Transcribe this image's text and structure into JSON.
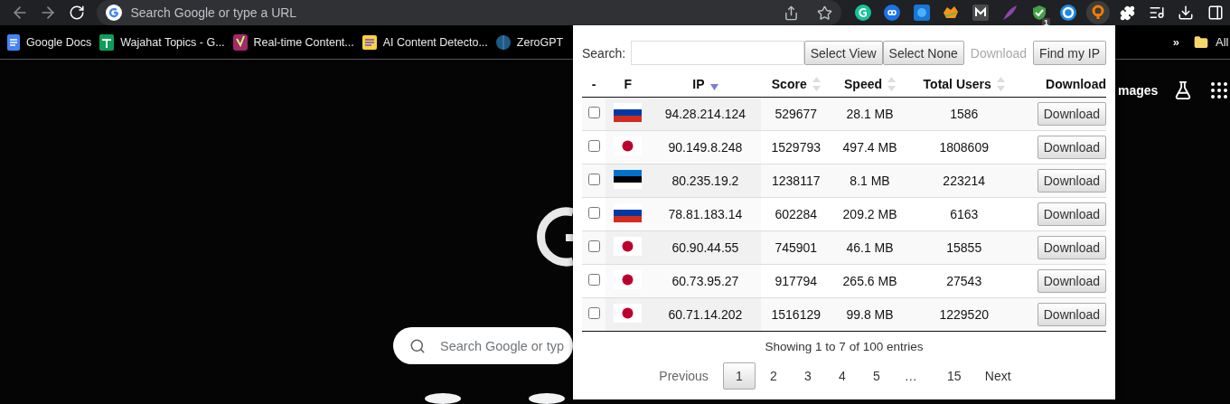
{
  "browser": {
    "omnibox": {
      "placeholder": "Search Google or type a URL"
    },
    "extensions": [
      {
        "kind": "grammar"
      },
      {
        "kind": "infinity"
      },
      {
        "kind": "globe"
      },
      {
        "kind": "squirrel"
      },
      {
        "kind": "mark"
      },
      {
        "kind": "feather"
      },
      {
        "kind": "shield",
        "badge": "1"
      },
      {
        "kind": "circle"
      },
      {
        "kind": "vpn"
      }
    ],
    "bookmarks": [
      {
        "label": "Google Docs",
        "kind": "docs"
      },
      {
        "label": "Wajahat Topics - G...",
        "kind": "sheets"
      },
      {
        "label": "Real-time Content...",
        "kind": "yoast"
      },
      {
        "label": "AI Content Detecto...",
        "kind": "notes"
      },
      {
        "label": "ZeroGPT",
        "kind": "brain"
      }
    ],
    "bookmarks_overflow": "»",
    "all_bookmarks": "All"
  },
  "page": {
    "search": {
      "placeholder": "Search Google or typ"
    },
    "header_link": "mages"
  },
  "popup": {
    "search_label": "Search:",
    "buttons": [
      {
        "label": "Select View",
        "disabled": false
      },
      {
        "label": "Select None",
        "disabled": false
      },
      {
        "label": "Download",
        "disabled": true
      },
      {
        "label": "Find my IP",
        "disabled": false
      }
    ],
    "table": {
      "columns": [
        {
          "label": "-"
        },
        {
          "label": "F"
        },
        {
          "label": "IP",
          "sorted": true
        },
        {
          "label": "Score",
          "sorted": false
        },
        {
          "label": "Speed",
          "sorted": false
        },
        {
          "label": "Total Users",
          "sorted": false
        },
        {
          "label": "Download"
        }
      ],
      "rows": [
        {
          "checked": false,
          "kind": "ru",
          "ip": "94.28.214.124",
          "score": "529677",
          "speed": "28.1 MB",
          "users": "1586",
          "action": "Download"
        },
        {
          "checked": false,
          "kind": "jp",
          "ip": "90.149.8.248",
          "score": "1529793",
          "speed": "497.4 MB",
          "users": "1808609",
          "action": "Download"
        },
        {
          "checked": false,
          "kind": "ee",
          "ip": "80.235.19.2",
          "score": "1238117",
          "speed": "8.1 MB",
          "users": "223214",
          "action": "Download"
        },
        {
          "checked": false,
          "kind": "ru",
          "ip": "78.81.183.14",
          "score": "602284",
          "speed": "209.2 MB",
          "users": "6163",
          "action": "Download"
        },
        {
          "checked": false,
          "kind": "jp",
          "ip": "60.90.44.55",
          "score": "745901",
          "speed": "46.1 MB",
          "users": "15855",
          "action": "Download"
        },
        {
          "checked": false,
          "kind": "jp",
          "ip": "60.73.95.27",
          "score": "917794",
          "speed": "265.6 MB",
          "users": "27543",
          "action": "Download"
        },
        {
          "checked": false,
          "kind": "jp",
          "ip": "60.71.14.202",
          "score": "1516129",
          "speed": "99.8 MB",
          "users": "1229520",
          "action": "Download"
        }
      ]
    },
    "info": "Showing 1 to 7 of 100 entries",
    "pagination": {
      "previous": "Previous",
      "next": "Next",
      "pages": [
        {
          "label": "1",
          "selected": true
        },
        {
          "label": "2",
          "selected": false
        },
        {
          "label": "3",
          "selected": false
        },
        {
          "label": "4",
          "selected": false
        },
        {
          "label": "5",
          "selected": false
        },
        {
          "label": "…",
          "selected": false
        },
        {
          "label": "15",
          "selected": false
        }
      ]
    }
  }
}
